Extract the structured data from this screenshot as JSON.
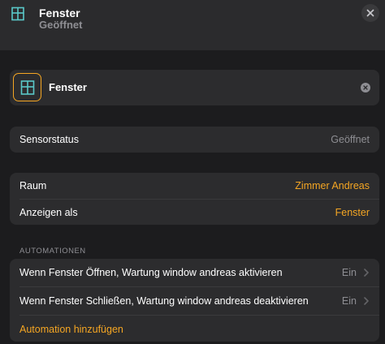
{
  "header": {
    "icon": "window-icon",
    "title": "Fenster",
    "subtitle": "Geöffnet",
    "close_icon": "close-icon"
  },
  "accessory": {
    "icon": "window-icon",
    "name": "Fenster",
    "clear_icon": "clear-icon"
  },
  "sensor": {
    "label": "Sensorstatus",
    "value": "Geöffnet"
  },
  "room": {
    "room_label": "Raum",
    "room_value": "Zimmer Andreas",
    "display_label": "Anzeigen als",
    "display_value": "Fenster"
  },
  "automations": {
    "header": "AUTOMATIONEN",
    "items": [
      {
        "label": "Wenn Fenster Öffnen, Wartung window andreas aktivieren",
        "status": "Ein"
      },
      {
        "label": "Wenn Fenster Schließen, Wartung window andreas deaktivieren",
        "status": "Ein"
      }
    ],
    "add_label": "Automation hinzufügen"
  },
  "colors": {
    "accent": "#f5a623",
    "icon_teal": "#5ac8c8",
    "background": "#1c1c1e",
    "card": "#2c2c2e",
    "secondary_text": "#8e8e93"
  }
}
